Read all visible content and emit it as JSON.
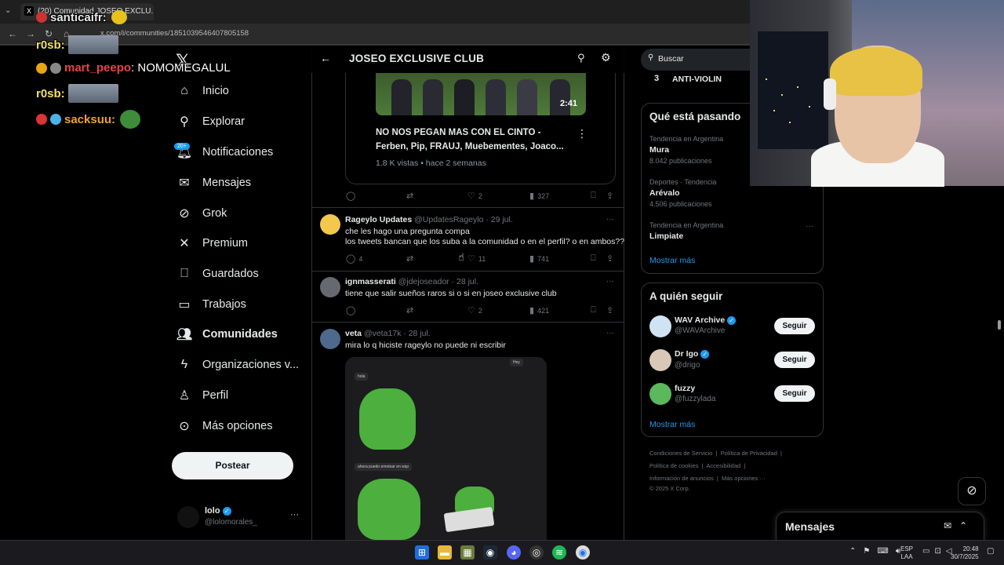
{
  "browser": {
    "tab_title": "(20) Comunidad JOSEO EXCLU...",
    "url": "x.com/i/communities/1851039546407805158"
  },
  "chat": [
    {
      "user": "santicaifr:",
      "msg": ""
    },
    {
      "user": "r0sb:",
      "msg": ""
    },
    {
      "user": "mart_peepo",
      "msg": ": NOMOMEGALUL"
    },
    {
      "user": "r0sb:",
      "msg": ""
    },
    {
      "user": "sacksuu:",
      "msg": ""
    }
  ],
  "sidebar": {
    "items": [
      {
        "label": "Inicio",
        "icon": "home-icon"
      },
      {
        "label": "Explorar",
        "icon": "search-icon"
      },
      {
        "label": "Notificaciones",
        "icon": "bell-icon"
      },
      {
        "label": "Mensajes",
        "icon": "mail-icon"
      },
      {
        "label": "Grok",
        "icon": "grok-icon"
      },
      {
        "label": "Premium",
        "icon": "x-icon"
      },
      {
        "label": "Guardados",
        "icon": "bookmark-icon"
      },
      {
        "label": "Trabajos",
        "icon": "briefcase-icon"
      },
      {
        "label": "Comunidades",
        "icon": "people-icon"
      },
      {
        "label": "Organizaciones v...",
        "icon": "lightning-icon"
      },
      {
        "label": "Perfil",
        "icon": "person-icon"
      },
      {
        "label": "Más opciones",
        "icon": "more-circle-icon"
      }
    ],
    "notif_badge": "20+",
    "post_label": "Postear",
    "account": {
      "name": "lolo",
      "handle": "@lolomorales_"
    }
  },
  "community": {
    "title": "JOSEO EXCLUSIVE CLUB"
  },
  "video_post": {
    "duration": "2:41",
    "title": "NO NOS PEGAN MAS CON EL CINTO - Ferben, Pip, FRAUJ, Muebementes, Joaco...",
    "meta": "1.8 K vistas • hace 2 semanas",
    "stats": {
      "replies": "",
      "likes": "2",
      "views": "327"
    }
  },
  "tweets": [
    {
      "name": "Rageylo Updates",
      "handle": "@UpdatesRageylo · 29 jul.",
      "lines": [
        "che les hago una pregunta compa",
        "los tweets bancan que los suba a la comunidad o en el perfil? o en ambos??"
      ],
      "stats": {
        "replies": "4",
        "likes": "11",
        "views": "741"
      }
    },
    {
      "name": "ignmasserati",
      "handle": "@jdejoseador · 28 jul.",
      "lines": [
        "tiene que salir sueños raros si o si en joseo exclusive club"
      ],
      "stats": {
        "replies": "",
        "likes": "2",
        "views": "421"
      }
    },
    {
      "name": "veta",
      "handle": "@veta17k · 28 jul.",
      "lines": [
        "mira lo q hiciste rageylo no puede ni escribir"
      ],
      "stats": {}
    }
  ],
  "attachment": {
    "bubble1": "hola",
    "bubble2": "ahora puedo emotear en wsp",
    "corner": "Hey"
  },
  "right": {
    "search_placeholder": "Buscar",
    "top_rank": "3",
    "top_label": "ANTI-VIOLIN",
    "trends_title": "Qué está pasando",
    "trends": [
      {
        "cat": "Tendencia en Argentina",
        "name": "Mura",
        "count": "8.042 publicaciones"
      },
      {
        "cat": "Deportes · Tendencia",
        "name": "Arévalo",
        "count": "4.506 publicaciones"
      },
      {
        "cat": "Tendencia en Argentina",
        "name": "Limpiate",
        "count": ""
      }
    ],
    "show_more": "Mostrar más",
    "follow_title": "A quién seguir",
    "follow": [
      {
        "name": "WAV Archive",
        "handle": "@WAVArchive",
        "verified": true,
        "btn": "Seguir",
        "color": "#cfe3f2"
      },
      {
        "name": "Dr Igo",
        "handle": "@drigo",
        "verified": true,
        "btn": "Seguir",
        "color": "#d9c8b8"
      },
      {
        "name": "fuzzy",
        "handle": "@fuzzylada",
        "verified": false,
        "btn": "Seguir",
        "color": "#5cb85c"
      }
    ],
    "follow_more": "Mostrar más",
    "footer": {
      "l1a": "Condiciones de Servicio",
      "l1b": "Política de Privacidad",
      "l2a": "Política de cookies",
      "l2b": "Accesibilidad",
      "l3a": "Información de anuncios",
      "l3b": "Más opciones ···",
      "copy": "© 2025 X Corp."
    }
  },
  "messages_drawer": {
    "title": "Mensajes"
  },
  "taskbar": {
    "lang1": "ESP",
    "lang2": "LAA",
    "time": "20:48",
    "date": "30/7/2025"
  }
}
